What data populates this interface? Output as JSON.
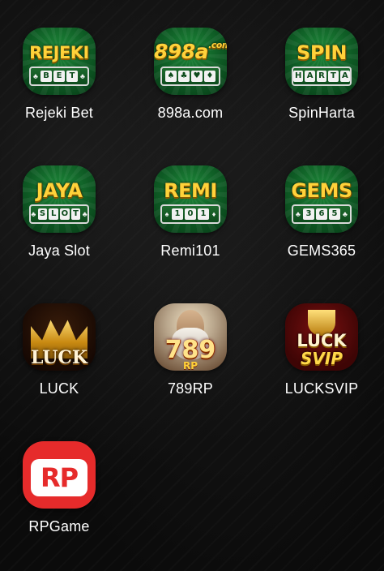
{
  "apps": [
    {
      "label": "Rejeki Bet",
      "icon": {
        "title": "REJEKI",
        "plate": [
          "♣",
          "B",
          "E",
          "T",
          "♣"
        ]
      }
    },
    {
      "label": "898a.com",
      "icon": {
        "title": "898a",
        "suffix": ".com",
        "plate": [
          "♠",
          "♣",
          "♥",
          "♦"
        ]
      }
    },
    {
      "label": "SpinHarta",
      "icon": {
        "title": "SPIN",
        "plate": [
          "H",
          "A",
          "R",
          "T",
          "A"
        ]
      }
    },
    {
      "label": "Jaya Slot",
      "icon": {
        "title": "JAYA",
        "plate": [
          "♣",
          "S",
          "L",
          "O",
          "T",
          "♣"
        ]
      }
    },
    {
      "label": "Remi101",
      "icon": {
        "title": "REMI",
        "plate": [
          "♠",
          "1",
          "0",
          "1",
          "♦"
        ]
      }
    },
    {
      "label": "GEMS365",
      "icon": {
        "title": "GEMS",
        "plate": [
          "♣",
          "3",
          "6",
          "5",
          "♣"
        ]
      }
    },
    {
      "label": "LUCK",
      "icon": {
        "title": "LUCK"
      }
    },
    {
      "label": "789RP",
      "icon": {
        "title": "789",
        "sub": "RP"
      }
    },
    {
      "label": "LUCKSVIP",
      "icon": {
        "title_top": "LUCK",
        "title_bottom": "SVIP"
      }
    },
    {
      "label": "RPGame",
      "icon": {
        "title": "RP"
      }
    }
  ],
  "colors": {
    "background": "#0b0b0b",
    "label_text": "#ffffff",
    "casino_green": "#0e5a24",
    "gold": "#ffd23a",
    "rpgame_red": "#e62b2b"
  }
}
